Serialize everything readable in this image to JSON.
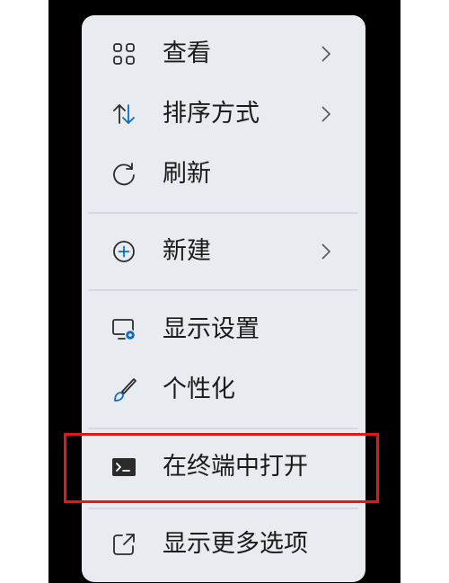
{
  "context_menu": {
    "items": [
      {
        "label": "查看",
        "icon": "grid-view-icon",
        "has_submenu": true
      },
      {
        "label": "排序方式",
        "icon": "sort-arrows-icon",
        "has_submenu": true
      },
      {
        "label": "刷新",
        "icon": "refresh-icon",
        "has_submenu": false
      },
      {
        "label": "新建",
        "icon": "plus-circle-icon",
        "has_submenu": true
      },
      {
        "label": "显示设置",
        "icon": "display-settings-icon",
        "has_submenu": false
      },
      {
        "label": "个性化",
        "icon": "paintbrush-icon",
        "has_submenu": false
      },
      {
        "label": "在终端中打开",
        "icon": "terminal-icon",
        "has_submenu": false
      },
      {
        "label": "显示更多选项",
        "icon": "open-external-icon",
        "has_submenu": false
      }
    ]
  },
  "colors": {
    "menu_background": "#e8ecf1",
    "text": "#1b1b1b",
    "accent_blue": "#0f6cbd",
    "highlight_outline": "#e8141b",
    "outer_background": "#000000"
  }
}
